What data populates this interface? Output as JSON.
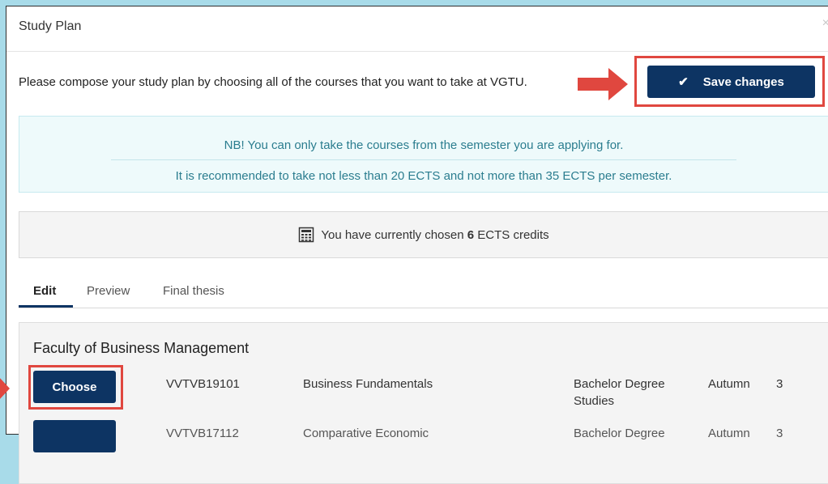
{
  "modal": {
    "title": "Study Plan",
    "close_glyph": "×"
  },
  "intro": {
    "text": "Please compose your study plan by choosing all of the courses that you want to take at VGTU."
  },
  "save_button": {
    "label": "Save changes",
    "icon": "check-icon"
  },
  "notice": {
    "line1": "NB! You can only take the courses from the semester you are applying for.",
    "line2": "It is recommended to take not less than 20 ECTS and not more than 35 ECTS per semester."
  },
  "credits": {
    "prefix": "You have currently chosen ",
    "value": "6",
    "suffix": " ECTS credits",
    "icon": "calculator-icon"
  },
  "tabs": [
    {
      "label": "Edit",
      "active": true
    },
    {
      "label": "Preview",
      "active": false
    },
    {
      "label": "Final thesis",
      "active": false
    }
  ],
  "faculty": {
    "title": "Faculty of Business Management",
    "courses": [
      {
        "button": "Choose",
        "code": "VVTVB19101",
        "name": "Business Fundamentals",
        "level": "Bachelor Degree Studies",
        "semester": "Autumn",
        "credits": "3"
      },
      {
        "button": "",
        "code": "VVTVB17112",
        "name": "Comparative Economic",
        "level": "Bachelor Degree",
        "semester": "Autumn",
        "credits": "3"
      }
    ]
  },
  "colors": {
    "primary": "#0d3463",
    "highlight": "#e0473f",
    "info_text": "#2b7d8f",
    "info_bg": "#eefafb",
    "backdrop": "#a8dbe9"
  }
}
